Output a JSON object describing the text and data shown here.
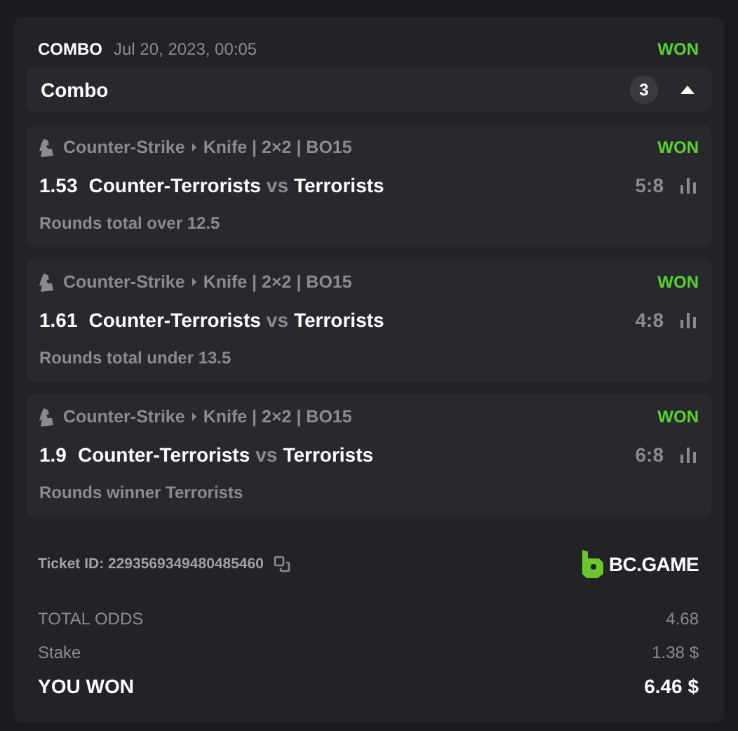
{
  "header": {
    "type": "COMBO",
    "date": "Jul 20, 2023, 00:05",
    "status": "WON"
  },
  "combo_bar": {
    "title": "Combo",
    "count": "3",
    "expanded": true
  },
  "legs": [
    {
      "sport": "Counter-Strike",
      "league": "Knife | 2×2 | BO15",
      "status": "WON",
      "odds": "1.53",
      "team1": "Counter-Terrorists",
      "vs": "vs",
      "team2": "Terrorists",
      "score": "5:8",
      "market": "Rounds total over 12.5"
    },
    {
      "sport": "Counter-Strike",
      "league": "Knife | 2×2 | BO15",
      "status": "WON",
      "odds": "1.61",
      "team1": "Counter-Terrorists",
      "vs": "vs",
      "team2": "Terrorists",
      "score": "4:8",
      "market": "Rounds total under 13.5"
    },
    {
      "sport": "Counter-Strike",
      "league": "Knife | 2×2 | BO15",
      "status": "WON",
      "odds": "1.9",
      "team1": "Counter-Terrorists",
      "vs": "vs",
      "team2": "Terrorists",
      "score": "6:8",
      "market": "Rounds winner Terrorists"
    }
  ],
  "ticket": {
    "label": "Ticket ID: 2293569349480485460",
    "logo_text": "BC.GAME"
  },
  "totals": [
    {
      "kind": "muted",
      "label": "TOTAL ODDS",
      "value": "4.68"
    },
    {
      "kind": "muted",
      "label": "Stake",
      "value": "1.38 $"
    },
    {
      "kind": "strong",
      "label": "YOU WON",
      "value": "6.46 $"
    }
  ]
}
